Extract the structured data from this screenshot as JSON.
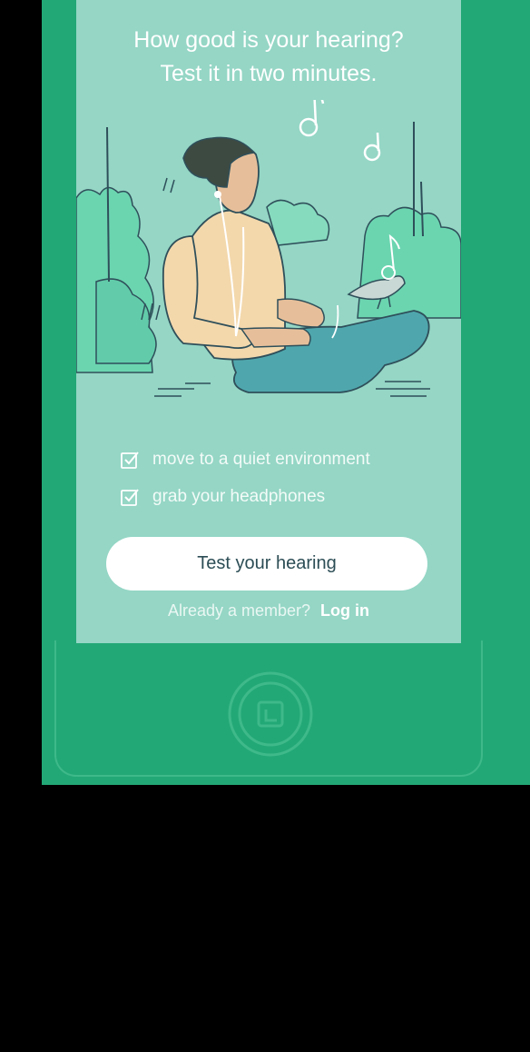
{
  "hero": {
    "line1": "How good is your hearing?",
    "line2": "Test it in two minutes."
  },
  "checklist": [
    {
      "label": "move to a quiet environment",
      "icon": "checkbox-checked-icon"
    },
    {
      "label": "grab your headphones",
      "icon": "checkbox-checked-icon"
    }
  ],
  "cta": {
    "label": "Test your hearing"
  },
  "login": {
    "prompt": "Already a member?",
    "link": "Log in"
  },
  "colors": {
    "device_green": "#22a876",
    "screen_bg": "#95d6c5",
    "button_text": "#2c4d55"
  },
  "icons": {
    "home_button": "home-button-icon",
    "illustration": "man-with-headphones-illustration"
  }
}
